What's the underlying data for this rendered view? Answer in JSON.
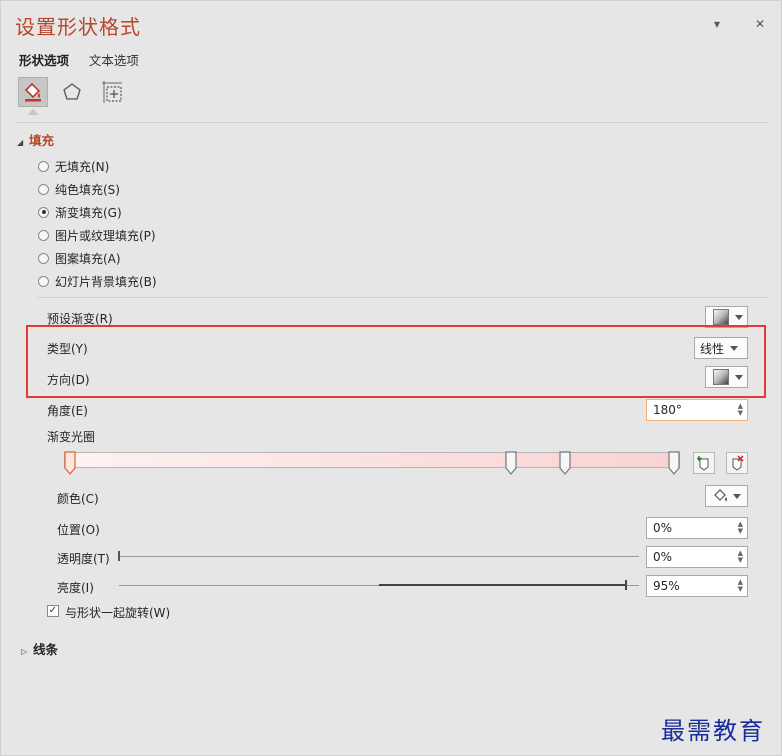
{
  "panel": {
    "title": "设置形状格式",
    "dropdown_glyph": "▾",
    "close_glyph": "✕",
    "tabs": [
      "形状选项",
      "文本选项"
    ],
    "icon_tabs": [
      "fill-line-icon",
      "effects-pentagon-icon",
      "size-properties-icon"
    ]
  },
  "fill": {
    "section_label": "填充",
    "options": [
      {
        "label": "无填充(N)",
        "checked": false
      },
      {
        "label": "纯色填充(S)",
        "checked": false
      },
      {
        "label": "渐变填充(G)",
        "checked": true
      },
      {
        "label": "图片或纹理填充(P)",
        "checked": false
      },
      {
        "label": "图案填充(A)",
        "checked": false
      },
      {
        "label": "幻灯片背景填充(B)",
        "checked": false
      }
    ],
    "preset_label": "预设渐变(R)",
    "type_label": "类型(Y)",
    "type_value": "线性",
    "direction_label": "方向(D)",
    "angle_label": "角度(E)",
    "angle_value": "180°",
    "stops_label": "渐变光圈",
    "stop_positions": [
      0,
      0.73,
      0.82,
      1.0
    ],
    "color_label": "颜色(C)",
    "position_label": "位置(O)",
    "position_value": "0%",
    "transparency_label": "透明度(T)",
    "transparency_value": "0%",
    "brightness_label": "亮度(I)",
    "brightness_value": "95%",
    "rotate_label": "与形状一起旋转(W)",
    "rotate_checked": true
  },
  "line": {
    "section_label": "线条"
  },
  "watermark": "最需教育",
  "colors": {
    "title": "#b7472a",
    "highlight": "#e53935",
    "watermark": "#1a2d9c"
  }
}
